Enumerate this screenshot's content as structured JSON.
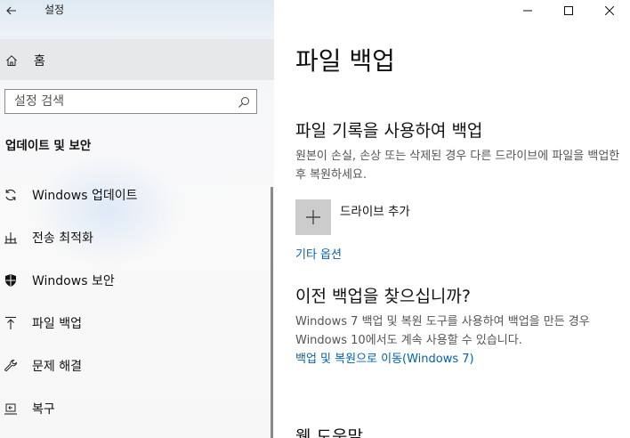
{
  "window": {
    "title": "설정"
  },
  "sidebar": {
    "home_label": "홈",
    "search": {
      "placeholder": "설정 검색",
      "value": ""
    },
    "section_title": "업데이트 및 보안",
    "items": [
      {
        "label": "Windows 업데이트",
        "icon": "sync-icon"
      },
      {
        "label": "전송 최적화",
        "icon": "delivery-optimization-icon"
      },
      {
        "label": "Windows 보안",
        "icon": "shield-icon"
      },
      {
        "label": "파일 백업",
        "icon": "backup-arrow-icon"
      },
      {
        "label": "문제 해결",
        "icon": "wrench-icon"
      },
      {
        "label": "복구",
        "icon": "recovery-icon"
      }
    ]
  },
  "content": {
    "title": "파일 백업",
    "file_history": {
      "heading": "파일 기록을 사용하여 백업",
      "description": "원본이 손실, 손상 또는 삭제된 경우 다른 드라이브에 파일을 백업한 후 복원하세요.",
      "add_drive_label": "드라이브 추가",
      "more_options_link": "기타 옵션"
    },
    "older_backup": {
      "heading": "이전 백업을 찾으십니까?",
      "description": "Windows 7 백업 및 복원 도구를 사용하여 백업을 만든 경우 Windows 10에서도 계속 사용할 수 있습니다.",
      "link": "백업 및 복원으로 이동(Windows 7)"
    },
    "help_heading": "웹 도움말"
  },
  "colors": {
    "link": "#0063b1",
    "add_tile": "#cccccc",
    "scrollbar": "#8a8a8a"
  }
}
